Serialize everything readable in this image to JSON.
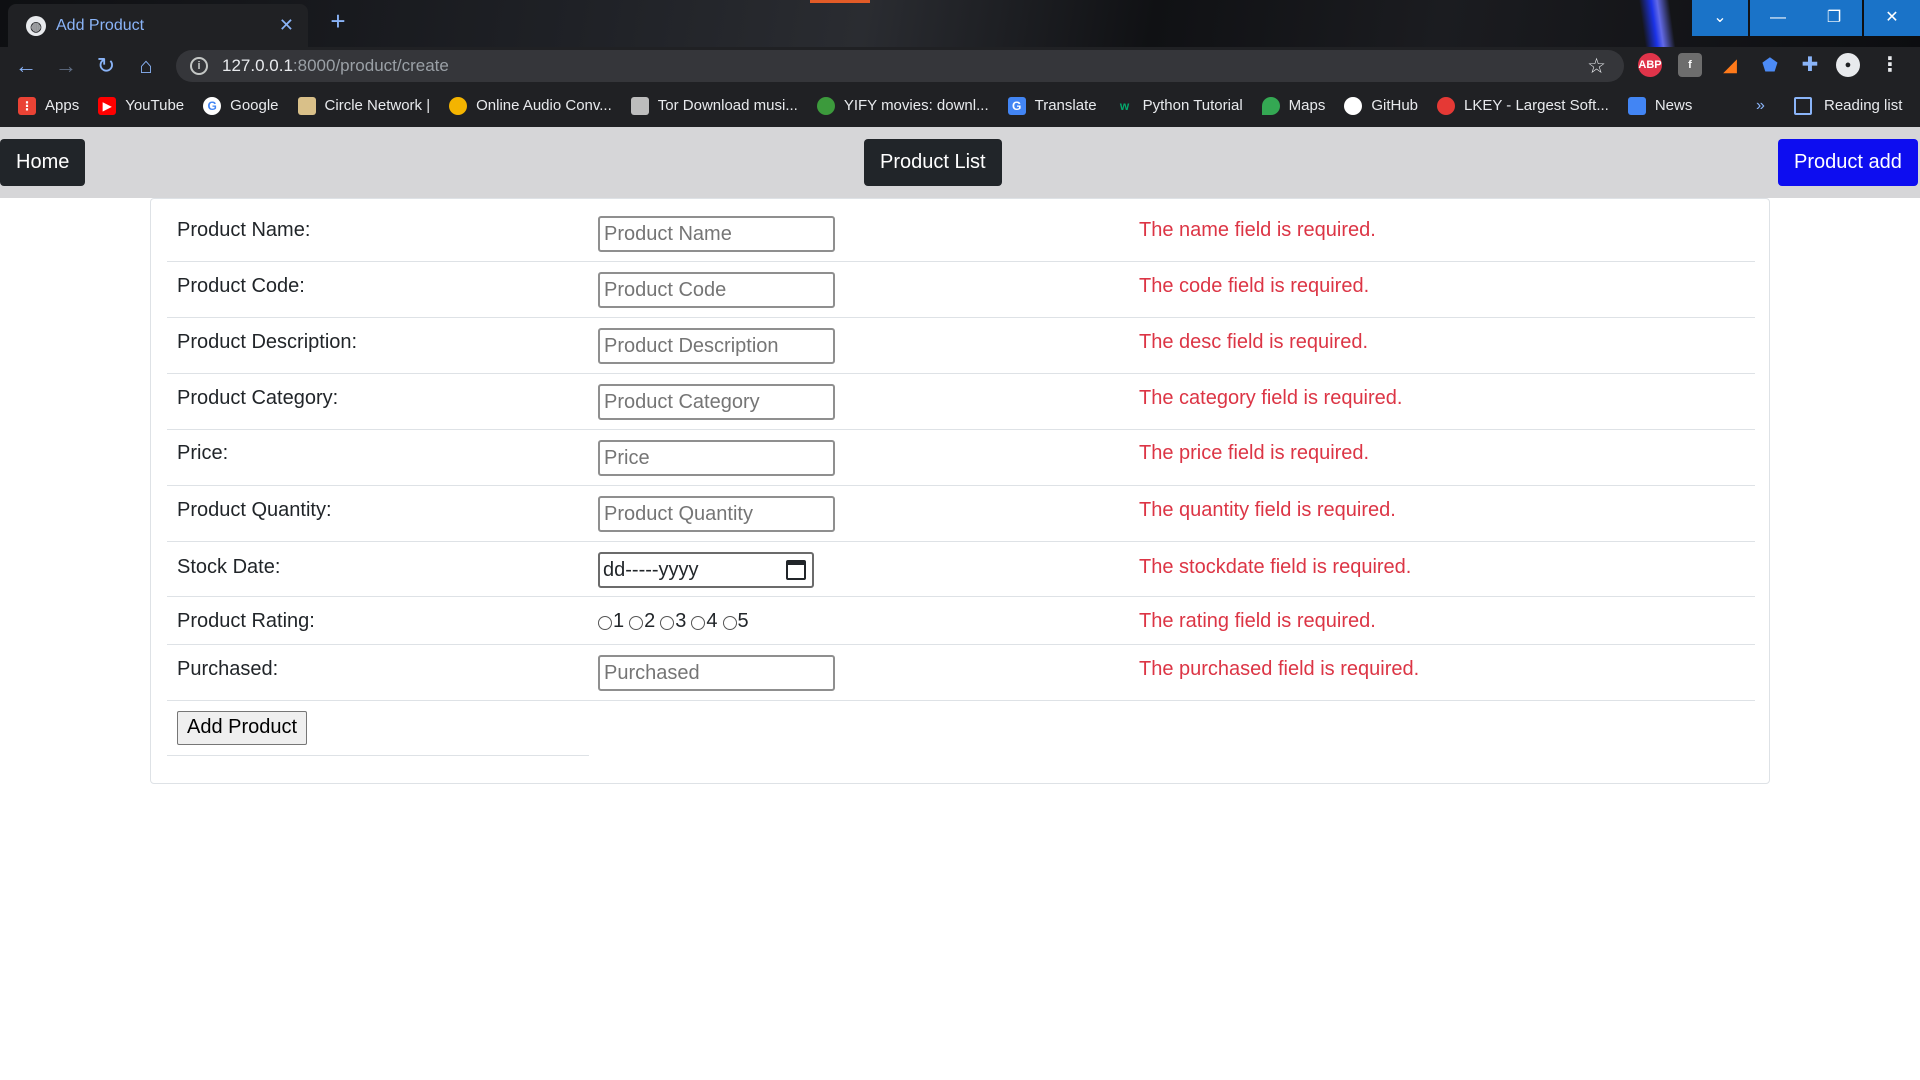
{
  "browser": {
    "tab_title": "Add Product",
    "tab_close": "✕",
    "new_tab": "+",
    "url_host": "127.0.0.1",
    "url_path": ":8000/product/create",
    "extensions": [
      "ABP"
    ],
    "window_controls": [
      "⌄",
      "—",
      "❐",
      "✕"
    ]
  },
  "bookmarks": {
    "items": [
      {
        "label": "Apps",
        "icon": "apps-grid-icon",
        "color": "#ea4335"
      },
      {
        "label": "YouTube",
        "icon": "youtube-icon",
        "color": "#ff0000"
      },
      {
        "label": "Google",
        "icon": "google-icon",
        "color": "#ffffff"
      },
      {
        "label": "Circle Network |",
        "icon": "circle-network-icon",
        "color": "#d9c089"
      },
      {
        "label": "Online Audio Conv...",
        "icon": "audio-converter-icon",
        "color": "#f4b400"
      },
      {
        "label": "Tor Download musi...",
        "icon": "tor-download-icon",
        "color": "#bdbdbd"
      },
      {
        "label": "YIFY movies: downl...",
        "icon": "yify-icon",
        "color": "#3c9a3c"
      },
      {
        "label": "Translate",
        "icon": "translate-icon",
        "color": "#4285f4"
      },
      {
        "label": "Python Tutorial",
        "icon": "w3schools-icon",
        "color": "#04aa6d"
      },
      {
        "label": "Maps",
        "icon": "maps-pin-icon",
        "color": "#34a853"
      },
      {
        "label": "GitHub",
        "icon": "github-icon",
        "color": "#ffffff"
      },
      {
        "label": "LKEY - Largest Soft...",
        "icon": "lkey-icon",
        "color": "#e53935"
      },
      {
        "label": "News",
        "icon": "news-icon",
        "color": "#4285f4"
      }
    ],
    "more": "»",
    "reading_list": "Reading list"
  },
  "navbar": {
    "home": "Home",
    "product_list": "Product List",
    "product_add": "Product add",
    "accent": "#0d0df0"
  },
  "form": {
    "fields": [
      {
        "label": "Product Name:",
        "placeholder": "Product Name",
        "error": "The name field is required."
      },
      {
        "label": "Product Code:",
        "placeholder": "Product Code",
        "error": "The code field is required."
      },
      {
        "label": "Product Description:",
        "placeholder": "Product Description",
        "error": "The desc field is required."
      },
      {
        "label": "Product Category:",
        "placeholder": "Product Category",
        "error": "The category field is required."
      },
      {
        "label": "Price:",
        "placeholder": "Price",
        "error": "The price field is required."
      },
      {
        "label": "Product Quantity:",
        "placeholder": "Product Quantity",
        "error": "The quantity field is required."
      }
    ],
    "stock_date": {
      "label": "Stock Date:",
      "value": "dd-----yyyy",
      "error": "The stockdate field is required."
    },
    "rating": {
      "label": "Product Rating:",
      "options": [
        "1",
        "2",
        "3",
        "4",
        "5"
      ],
      "error": "The rating field is required."
    },
    "purchased": {
      "label": "Purchased:",
      "placeholder": "Purchased",
      "error": "The purchased field is required."
    },
    "submit": "Add Product",
    "error_color": "#dc3545"
  }
}
